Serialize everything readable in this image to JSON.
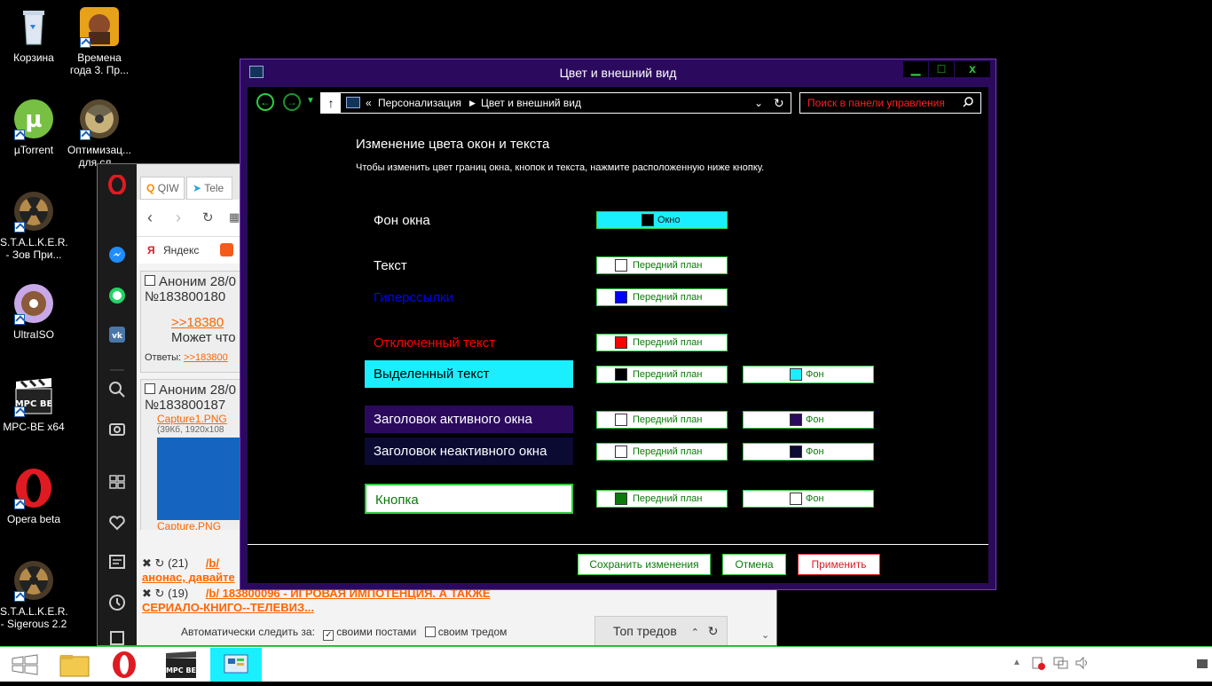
{
  "desktop": {
    "icons": [
      {
        "label": "Корзина",
        "icon": "recycle-bin-icon"
      },
      {
        "label": "Времена года 3. Пр...",
        "icon": "game-icon"
      },
      {
        "label": "µTorrent",
        "icon": "utorrent-icon"
      },
      {
        "label": "Оптимизац... для сл...",
        "icon": "radiation-icon"
      },
      {
        "label": "S.T.A.L.K.E.R. - Зов При...",
        "icon": "stalker-icon"
      },
      {
        "label": "UltraISO",
        "icon": "disc-icon"
      },
      {
        "label": "MPC-BE x64",
        "icon": "clapperboard-icon"
      },
      {
        "label": "Opera beta",
        "icon": "opera-icon"
      },
      {
        "label": "S.T.A.L.K.E.R. - Sigerous 2.2",
        "icon": "stalker-icon"
      }
    ]
  },
  "opera": {
    "tabs": [
      "QIW",
      "Tele"
    ],
    "bookmark": "Яндекс",
    "posts": [
      {
        "head": "Аноним 28/0",
        "num": "№183800180",
        "link": ">>18380",
        "text": "Может что",
        "replies_label": "Ответы:",
        "replies": ">>183800"
      },
      {
        "head": "Аноним 28/0",
        "num": "№183800187",
        "file": "Capture1.PNG",
        "meta": "(39Кб, 1920x108",
        "file2": "Capture.PNG"
      }
    ],
    "threads": [
      {
        "count": "(21)",
        "title": "/b/",
        "sub": "анонас, давайте"
      },
      {
        "count": "(19)",
        "title": "/b/ 183800096 - ИГРОВАЯ ИМПОТЕНЦИЯ. А ТАКЖЕ",
        "sub": "СЕРИАЛО-КНИГО--ТЕЛЕВИЗ..."
      }
    ],
    "follow_label": "Автоматически следить за:",
    "follow_own": "своими постами",
    "follow_thread": "своим тредом",
    "top_threads": "Топ тредов"
  },
  "window": {
    "title": "Цвет и внешний вид",
    "breadcrumb_prefix": "«",
    "breadcrumb1": "Персонализация",
    "breadcrumb2": "Цвет и внешний вид",
    "search_placeholder": "Поиск в панели управления",
    "heading": "Изменение цвета окон и текста",
    "description": "Чтобы изменить цвет границ окна, кнопок и текста, нажмите расположенную ниже кнопку.",
    "rows": {
      "window_bg": {
        "label": "Фон окна",
        "btn": "Окно"
      },
      "text": {
        "label": "Текст",
        "btn": "Передний план"
      },
      "hyperlinks": {
        "label": "Гиперссылки",
        "btn": "Передний план"
      },
      "disabled": {
        "label": "Отключенный текст",
        "btn": "Передний план"
      },
      "selected": {
        "label": "Выделенный текст",
        "fg": "Передний план",
        "bg": "Фон"
      },
      "active_title": {
        "label": "Заголовок активного окна",
        "fg": "Передний план",
        "bg": "Фон"
      },
      "inactive_title": {
        "label": "Заголовок неактивного окна",
        "fg": "Передний план",
        "bg": "Фон"
      },
      "button": {
        "label": "Кнопка",
        "fg": "Передний план",
        "bg": "Фон"
      }
    },
    "footer": {
      "save": "Сохранить изменения",
      "cancel": "Отмена",
      "apply": "Применить"
    }
  },
  "colors": {
    "accent": "#2ecc40",
    "title_bar": "#2b0a5e",
    "selected_bg": "#1aefff",
    "hyperlink": "#0000ff",
    "disabled": "#ff0000",
    "inactive_title": "#0a0a33"
  }
}
